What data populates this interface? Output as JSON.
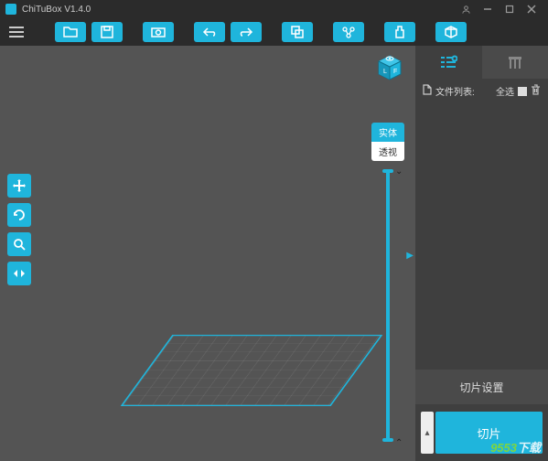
{
  "titlebar": {
    "app_title": "ChiTuBox V1.4.0"
  },
  "toolbar": {
    "buttons": [
      "open",
      "save",
      "screenshot",
      "undo",
      "redo",
      "copy",
      "support",
      "repair",
      "hollow"
    ]
  },
  "left_tools": [
    "move",
    "rotate",
    "scale",
    "mirror"
  ],
  "viewmode": {
    "solid": "实体",
    "perspective": "透视"
  },
  "rpanel": {
    "filelist_label": "文件列表:",
    "select_all": "全选",
    "slice_settings": "切片设置",
    "slice": "切片"
  },
  "watermark": {
    "text": "9553下载"
  },
  "colors": {
    "accent": "#1fb5dc",
    "panel": "#3f3f3f",
    "viewport": "#545454"
  }
}
